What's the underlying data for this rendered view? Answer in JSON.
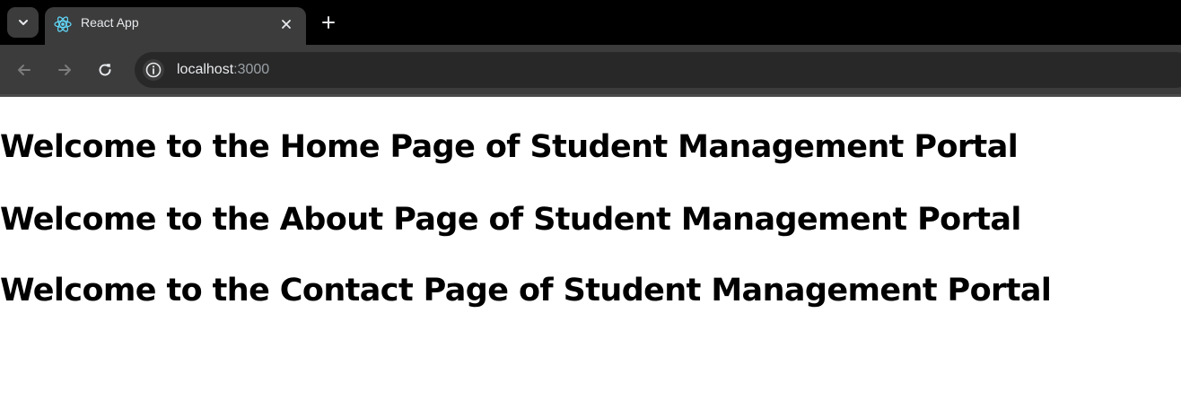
{
  "browser": {
    "tab": {
      "title": "React App",
      "favicon": "react-logo-icon"
    },
    "address_bar": {
      "host": "localhost",
      "port": ":3000"
    }
  },
  "content": {
    "headings": [
      "Welcome to the Home Page of Student Management Portal",
      "Welcome to the About Page of Student Management Portal",
      "Welcome to the Contact Page of Student Management Portal"
    ]
  },
  "colors": {
    "tabstrip_bg": "#000000",
    "toolbar_bg": "#3c3c3c",
    "omnibox_bg": "#282828",
    "page_bg": "#ffffff",
    "heading_text": "#000000"
  }
}
